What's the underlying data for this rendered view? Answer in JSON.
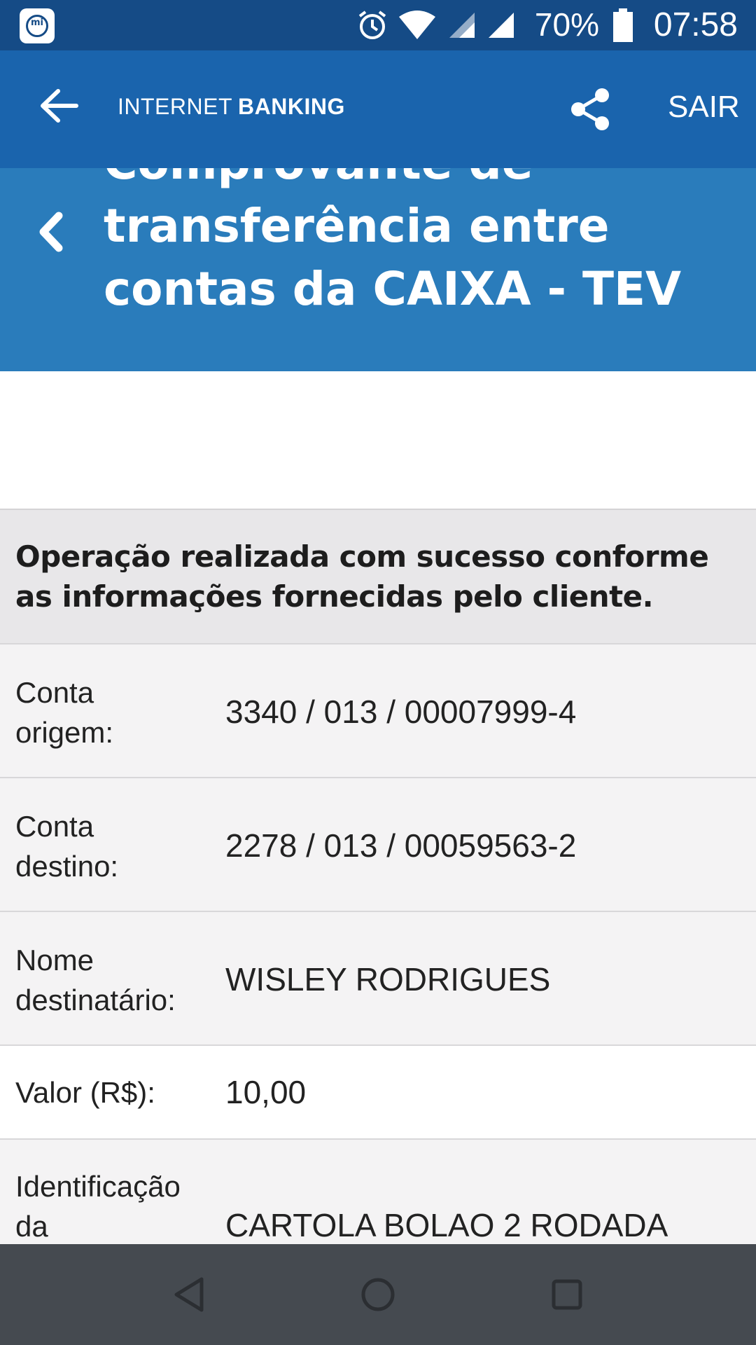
{
  "status_bar": {
    "battery_percent": "70%",
    "time": "07:58",
    "icons": [
      "mi-icon",
      "alarm-icon",
      "wifi-icon",
      "signal-icon",
      "signal-icon",
      "battery-icon"
    ]
  },
  "app_bar": {
    "brand_part1": "INTERNET",
    "brand_part2": "BANKING",
    "exit_label": "SAIR",
    "icons": [
      "back-arrow-icon",
      "share-icon"
    ]
  },
  "title": {
    "line1": "Comprovante de",
    "line2": "transferência entre",
    "line3": "contas da CAIXA - TEV"
  },
  "success_message": "Operação realizada com sucesso conforme as informações fornecidas pelo cliente.",
  "receipt": {
    "rows": [
      {
        "label_line1": "Conta",
        "label_line2": "origem:",
        "value": "3340 / 013 / 00007999-4"
      },
      {
        "label_line1": "Conta",
        "label_line2": "destino:",
        "value": "2278 / 013 / 00059563-2"
      },
      {
        "label_line1": "Nome",
        "label_line2": "destinatário:",
        "value": "WISLEY RODRIGUES"
      },
      {
        "label_line1": "Valor (R$):",
        "label_line2": "",
        "value": "10,00"
      },
      {
        "label_line1": "Identificação",
        "label_line2": "da",
        "value": "CARTOLA BOLAO 2 RODADA"
      }
    ]
  },
  "colors": {
    "status_bar": "#154b86",
    "app_bar": "#1a64ad",
    "title_banner": "#2a7cbb",
    "nav_bar": "#454a50"
  }
}
